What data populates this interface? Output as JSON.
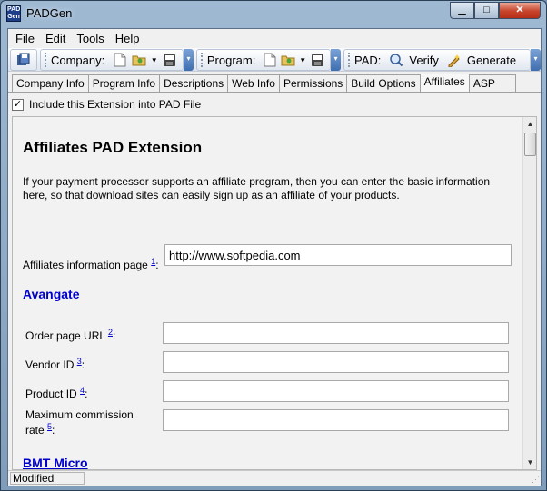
{
  "window": {
    "title": "PADGen",
    "app_icon_text": "PAD Gen",
    "minimize": "▁",
    "maximize": "□",
    "close": "✕"
  },
  "menu": {
    "file": "File",
    "edit": "Edit",
    "tools": "Tools",
    "help": "Help"
  },
  "toolbar": {
    "company_label": "Company:",
    "program_label": "Program:",
    "pad_label": "PAD:",
    "verify_label": "Verify",
    "generate_label": "Generate"
  },
  "tabs": [
    "Company Info",
    "Program Info",
    "Descriptions",
    "Web Info",
    "Permissions",
    "Build Options",
    "Affiliates",
    "ASP"
  ],
  "active_tab": "Affiliates",
  "include": {
    "label": "Include this Extension into PAD File",
    "checked": true,
    "mark": "✓"
  },
  "content": {
    "heading": "Affiliates PAD Extension",
    "intro": "If your payment processor supports an affiliate program, then you can enter the basic information here, so that download sites can easily sign up as an affiliate of your products.",
    "info_page_label": "Affiliates information page",
    "info_page_ref": "1",
    "info_page_value": "http://www.softpedia.com",
    "avangate": {
      "heading": "Avangate",
      "order_page_label": "Order page URL",
      "order_page_ref": "2",
      "order_page_value": "",
      "vendor_id_label": "Vendor ID",
      "vendor_id_ref": "3",
      "vendor_id_value": "",
      "product_id_label": "Product ID",
      "product_id_ref": "4",
      "product_id_value": "",
      "commission_label_1": "Maximum commission",
      "commission_label_2": "rate",
      "commission_ref": "5",
      "commission_value": ""
    },
    "bmt_micro": {
      "heading": "BMT Micro"
    }
  },
  "status": {
    "text": "Modified"
  }
}
